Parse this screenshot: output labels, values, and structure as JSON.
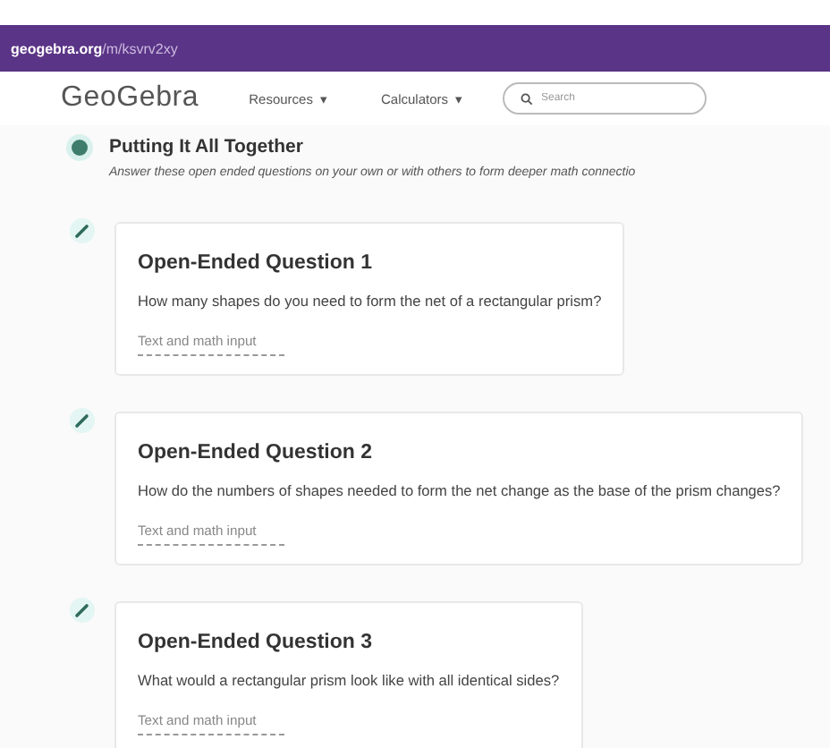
{
  "address_bar": {
    "domain": "geogebra.org",
    "path": "/m/ksvrv2xy"
  },
  "nav": {
    "logo": "GeoGebra",
    "menus": [
      {
        "label": "Resources",
        "icon": "▾"
      },
      {
        "label": "Calculators",
        "icon": "▾"
      }
    ],
    "search": {
      "placeholder": "Search"
    }
  },
  "section": {
    "title": "Putting It All Together",
    "description": "Answer these open ended questions on your own or with others to form deeper math connectio"
  },
  "questions": [
    {
      "title": "Open-Ended Question 1",
      "prompt": "How many shapes do you need to form the net of a rectangular prism?",
      "answer": {
        "placeholder": "Text and math input"
      }
    },
    {
      "title": "Open-Ended Question 2",
      "prompt": "How do the numbers of shapes needed to form the net change as the base of the prism changes?",
      "answer": {
        "placeholder": "Text and math input"
      }
    },
    {
      "title": "Open-Ended Question 3",
      "prompt": "What would a rectangular prism look like with all identical sides?",
      "answer": {
        "placeholder": "Text and math input"
      }
    }
  ]
}
